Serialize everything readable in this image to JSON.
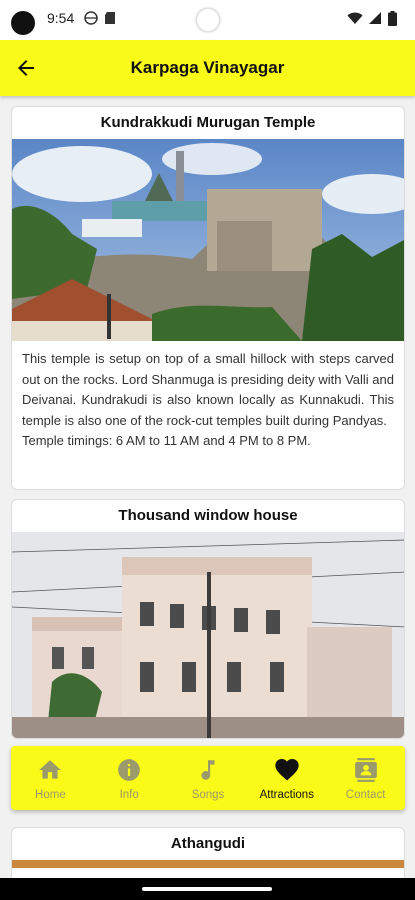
{
  "status": {
    "time": "9:54",
    "icons": [
      "camera-cutout",
      "globe-icon",
      "sd-card-icon",
      "wifi-icon",
      "signal-icon",
      "battery-icon"
    ]
  },
  "appbar": {
    "title": "Karpaga Vinayagar",
    "back_icon": "arrow-left-icon",
    "background": "#fafa18"
  },
  "cards": [
    {
      "title": "Kundrakkudi Murugan Temple",
      "paragraphs": [
        "This temple is setup on top of a small hillock with steps carved out on the rocks. Lord Shanmuga is presiding deity with Valli and Deivanai. Kundrakudi is also known locally as Kunnakudi. This temple is also one of the rock-cut temples built during Pandyas.",
        "Temple timings: 6 AM to 11 AM and 4 PM to 8 PM."
      ]
    },
    {
      "title": "Thousand window house"
    },
    {
      "title": "Athangudi"
    }
  ],
  "nav": {
    "items": [
      {
        "label": "Home",
        "icon": "home-icon",
        "active": false
      },
      {
        "label": "Info",
        "icon": "info-icon",
        "active": false
      },
      {
        "label": "Songs",
        "icon": "music-note-icon",
        "active": false
      },
      {
        "label": "Attractions",
        "icon": "heart-icon",
        "active": true
      },
      {
        "label": "Contact",
        "icon": "contact-card-icon",
        "active": false
      }
    ],
    "inactive_color": "#9a9a6a",
    "active_color": "#111111"
  }
}
